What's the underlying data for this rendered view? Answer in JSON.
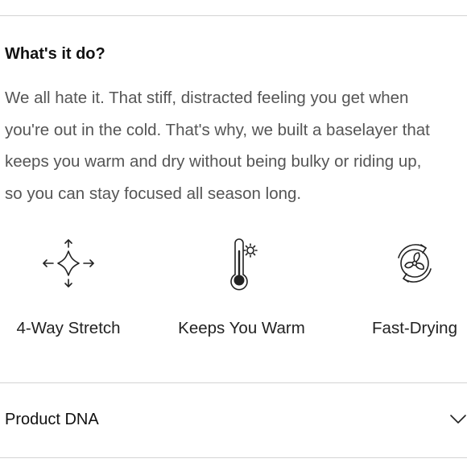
{
  "section": {
    "heading": "What's it do?",
    "description": "We all hate it. That stiff, distracted feeling you get when\nyou're out in the cold. That's why, we built a baselayer that\nkeeps you warm and dry without being bulky or riding up,\nso you can stay focused all season long."
  },
  "features": [
    {
      "icon": "four-way-arrows-icon",
      "label": "4-Way Stretch"
    },
    {
      "icon": "thermometer-sun-icon",
      "label": "Keeps You Warm"
    },
    {
      "icon": "fan-cycle-icon",
      "label": "Fast-Drying"
    }
  ],
  "accordion": {
    "title": "Product DNA",
    "icon": "chevron-down-icon"
  }
}
